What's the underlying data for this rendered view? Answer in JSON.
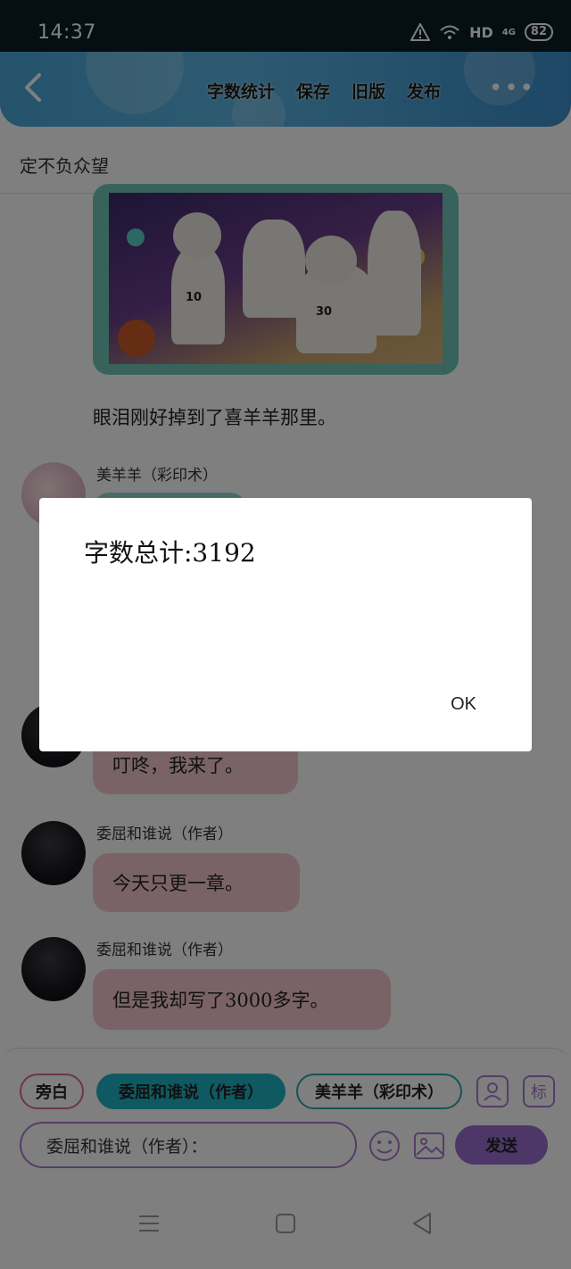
{
  "status_bar": {
    "time": "14:37",
    "network": "HD",
    "signal": "4G",
    "battery": "82"
  },
  "header": {
    "menu": [
      "字数统计",
      "保存",
      "旧版",
      "发布"
    ]
  },
  "subtitle": "定不负众望",
  "feed": {
    "image_numbers": [
      "10",
      "30"
    ],
    "caption": "眼泪刚好掉到了喜羊羊那里。",
    "messages": [
      {
        "name": "美羊羊（彩印术）",
        "text": ""
      },
      {
        "name": "",
        "text": "叮咚，我来了。"
      },
      {
        "name": "委屈和谁说（作者）",
        "text": "今天只更一章。"
      },
      {
        "name": "委屈和谁说（作者）",
        "text": "但是我却写了3000多字。"
      }
    ]
  },
  "composer": {
    "chips": [
      "旁白",
      "委屈和谁说（作者）",
      "美羊羊（彩印术）"
    ],
    "mark_label": "标",
    "input_text": "委屈和谁说（作者）：",
    "send_label": "发送"
  },
  "dialog": {
    "text": "字数总计:3192",
    "ok_label": "OK"
  }
}
